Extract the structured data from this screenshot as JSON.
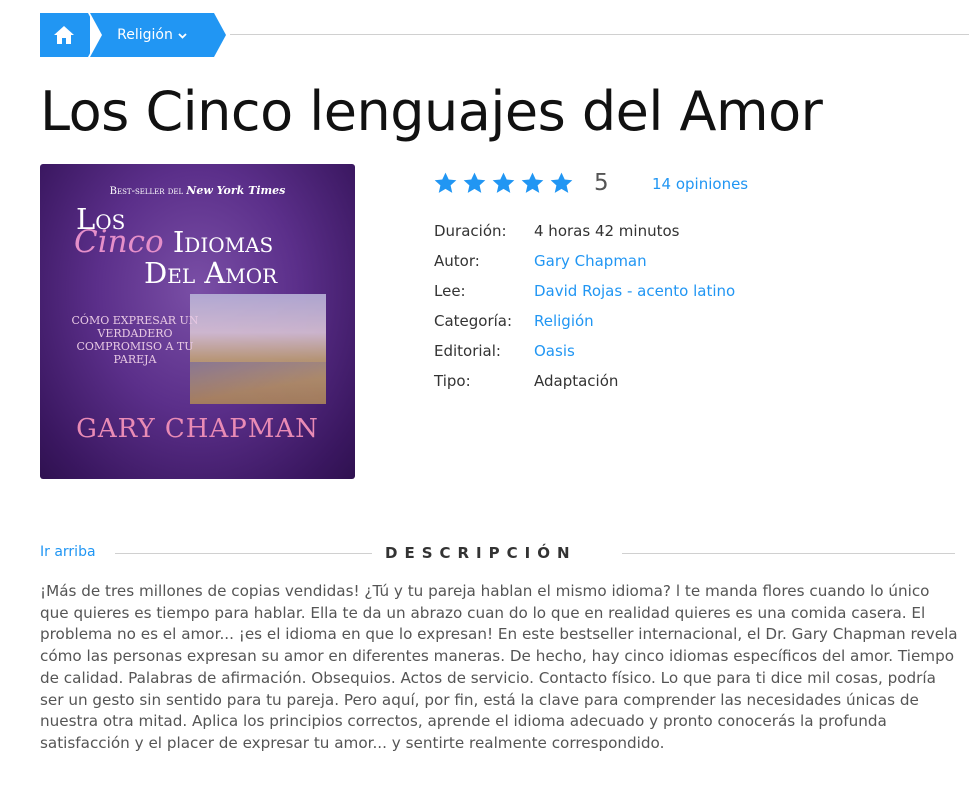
{
  "breadcrumb": {
    "home_icon": "home-icon",
    "category": "Religión",
    "chevron_icon": "chevron-down-icon"
  },
  "title": "Los Cinco lenguajes del Amor",
  "cover": {
    "top_line_prefix": "Best-seller del",
    "top_line_emph": "New York Times",
    "title_los": "Los",
    "title_cinco": "Cinco",
    "title_idiomas": "Idiomas",
    "title_del_amor": "Del Amor",
    "subtitle": "Cómo expresar un verdadero compromiso a tu pareja",
    "author": "GARY CHAPMAN"
  },
  "rating": {
    "stars": 5,
    "max_stars": 5,
    "value": "5",
    "reviews": "14 opiniones",
    "star_color": "#2196f3"
  },
  "details": [
    {
      "label": "Duración:",
      "value": "4 horas 42 minutos",
      "link": false
    },
    {
      "label": "Autor:",
      "value": "Gary Chapman",
      "link": true
    },
    {
      "label": "Lee:",
      "value": "David Rojas - acento latino",
      "link": true
    },
    {
      "label": "Categoría:",
      "value": "Religión",
      "link": true
    },
    {
      "label": "Editorial:",
      "value": "Oasis",
      "link": true
    },
    {
      "label": "Tipo:",
      "value": "Adaptación",
      "link": false
    }
  ],
  "section": {
    "go_top": "Ir arriba",
    "title": "DESCRIPCIÓN"
  },
  "description": "¡Más de tres millones de copias vendidas! ¿Tú y tu pareja hablan el mismo idioma? l te manda flores cuando lo único que quieres es tiempo para hablar. Ella te da un abrazo cuan do lo que en realidad quieres es una comida casera. El problema no es el amor... ¡es el idioma en que lo expresan! En este bestseller internacional, el Dr. Gary Chapman revela cómo las personas expresan su amor en diferentes maneras. De hecho, hay cinco idiomas específicos del amor. Tiempo de calidad. Palabras de afirmación. Obsequios. Actos de servicio. Contacto físico. Lo que para ti dice mil cosas, podría ser un gesto sin sentido para tu pareja. Pero aquí, por fin, está la clave para comprender las necesidades únicas de nuestra otra mitad. Aplica los principios correctos, aprende el idioma adecuado y pronto conocerás la profunda satisfacción y el placer de expresar tu amor... y sentirte realmente correspondido.",
  "colors": {
    "accent": "#2196f3",
    "cover_purple": "#5b2f8a"
  }
}
